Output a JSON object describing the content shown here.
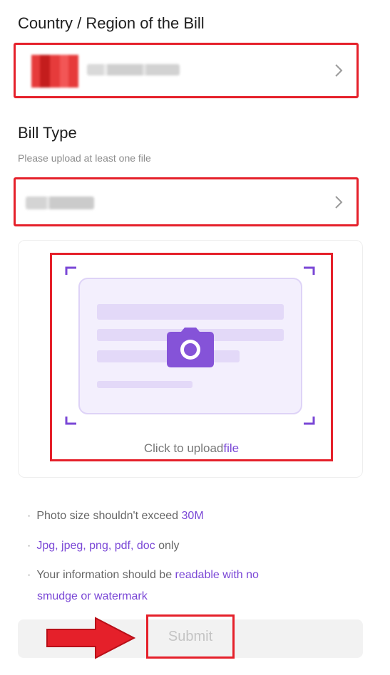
{
  "country_section": {
    "title": "Country / Region of the Bill",
    "value_icon": "flag-icon",
    "chevron_icon": "chevron-right-icon"
  },
  "bill_type_section": {
    "title": "Bill Type",
    "hint": "Please upload at least one file",
    "chevron_icon": "chevron-right-icon"
  },
  "upload": {
    "label_prefix": "Click to upload",
    "label_accent": "file",
    "icon": "camera-icon"
  },
  "tips": [
    {
      "before": "Photo size shouldn't exceed ",
      "accent": "30M",
      "after": ""
    },
    {
      "before": "",
      "accent": "Jpg, jpeg, png, pdf, doc",
      "after": " only"
    },
    {
      "before": "Your information should be ",
      "accent": "readable with no",
      "after": ""
    },
    {
      "before": "",
      "accent": "smudge or watermark",
      "after": ""
    }
  ],
  "submit": {
    "label": "Submit"
  },
  "colors": {
    "accent": "#7a47d6",
    "highlight": "#e5202a",
    "muted": "#8c8c8c"
  }
}
